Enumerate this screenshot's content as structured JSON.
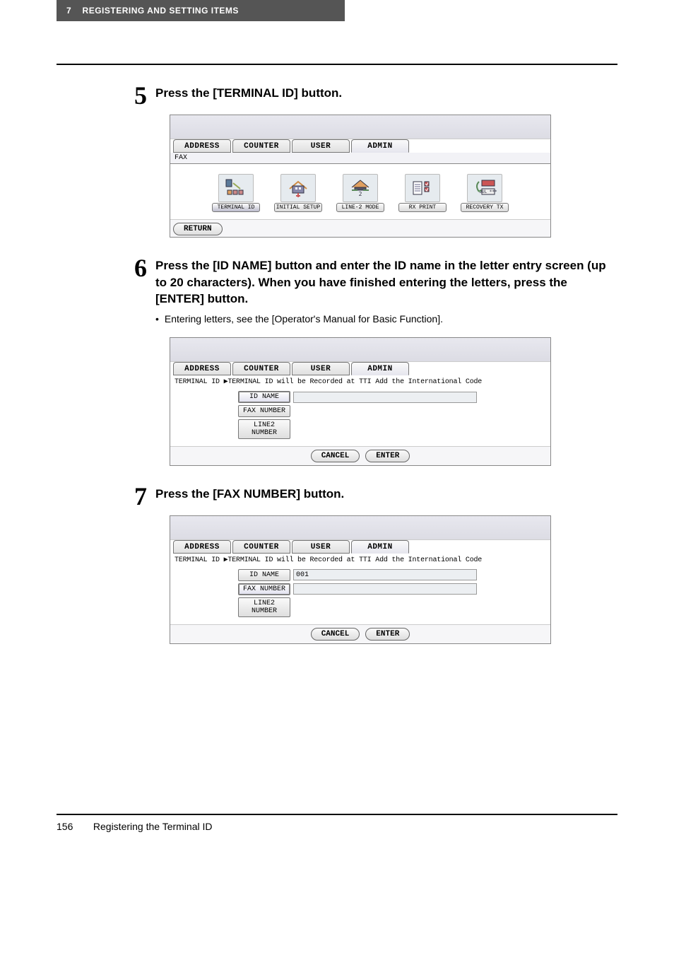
{
  "header": {
    "chapter_num": "7",
    "chapter_title": "REGISTERING AND SETTING ITEMS"
  },
  "steps": {
    "s5": {
      "num": "5",
      "title": "Press the [TERMINAL ID] button."
    },
    "s6": {
      "num": "6",
      "title": "Press the [ID NAME] button and enter the ID name in the letter entry screen (up to 20 characters). When you have finished entering the letters, press the [ENTER] button.",
      "bullet": "Entering letters, see the [Operator's Manual for Basic Function]."
    },
    "s7": {
      "num": "7",
      "title": "Press the [FAX NUMBER] button."
    }
  },
  "ui": {
    "tabs": {
      "address": "ADDRESS",
      "counter": "COUNTER",
      "user": "USER",
      "admin": "ADMIN"
    },
    "fax_label": "FAX",
    "icons": {
      "terminal_id": "TERMINAL ID",
      "initial_setup": "INITIAL SETUP",
      "line2_mode": "LINE-2 MODE",
      "rx_print": "RX PRINT",
      "recovery_tx": "RECOVERY TX"
    },
    "return": "RETURN",
    "terminal_msg": "TERMINAL ID ▶TERMINAL ID will be Recorded at TTI Add the International Code",
    "fields": {
      "id_name": "ID NAME",
      "fax_number": "FAX NUMBER",
      "line2_number": "LINE2 NUMBER"
    },
    "id_value_001": "001",
    "cancel": "CANCEL",
    "enter": "ENTER"
  },
  "footer": {
    "page": "156",
    "title": "Registering the Terminal ID"
  }
}
